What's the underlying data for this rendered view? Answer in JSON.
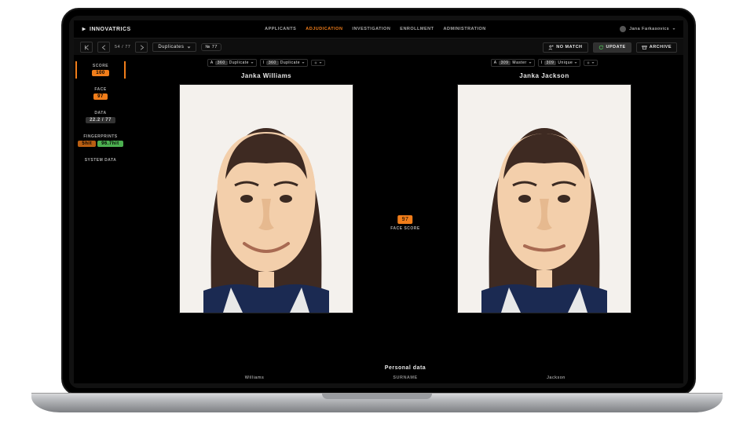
{
  "brand": "INNOVATRICS",
  "nav": {
    "items": [
      "APPLICANTS",
      "ADJUDICATION",
      "INVESTIGATION",
      "ENROLLMENT",
      "ADMINISTRATION"
    ],
    "active_index": 1
  },
  "user": {
    "name": "Jana Farkasovics"
  },
  "toolbar": {
    "pager": {
      "pos": "54",
      "total": "77"
    },
    "view_label": "Duplicates",
    "id_pill": "№ 77",
    "actions": {
      "no_match": "NO MATCH",
      "update": "UPDATE",
      "archive": "ARCHIVE"
    }
  },
  "sidebar": {
    "score": {
      "label": "SCORE",
      "value": "100"
    },
    "face": {
      "label": "FACE",
      "value": "97"
    },
    "data": {
      "label": "DATA",
      "value": "22.2 / 77"
    },
    "fingerprints": {
      "label": "FINGERPRINTS",
      "left": "5hit",
      "right": "96.7hit"
    },
    "system": {
      "label": "SYSTEM DATA"
    }
  },
  "compare": {
    "left": {
      "name": "Janka Williams",
      "chips": [
        {
          "k": "A",
          "v": "360",
          "tag": "Duplicate"
        },
        {
          "k": "I",
          "v": "360",
          "tag": "Duplicate"
        }
      ]
    },
    "right": {
      "name": "Janka Jackson",
      "chips": [
        {
          "k": "A",
          "v": "309",
          "tag": "Master"
        },
        {
          "k": "I",
          "v": "309",
          "tag": "Unique"
        }
      ]
    },
    "face_score": {
      "value": "97",
      "label": "FACE SCORE"
    }
  },
  "personal": {
    "title": "Personal data",
    "rows": [
      {
        "left": "Williams",
        "key": "SURNAME",
        "right": "Jackson"
      }
    ]
  },
  "icons": {
    "arrow_left": "‹",
    "arrow_right": "›",
    "arrow_left_bar": "⇤",
    "caret_down": "▾",
    "person": "person",
    "x": "✕",
    "refresh": "⟳",
    "archive": "archive",
    "plus": "+"
  },
  "colors": {
    "accent": "#f07d1a",
    "green": "#4caf50"
  }
}
